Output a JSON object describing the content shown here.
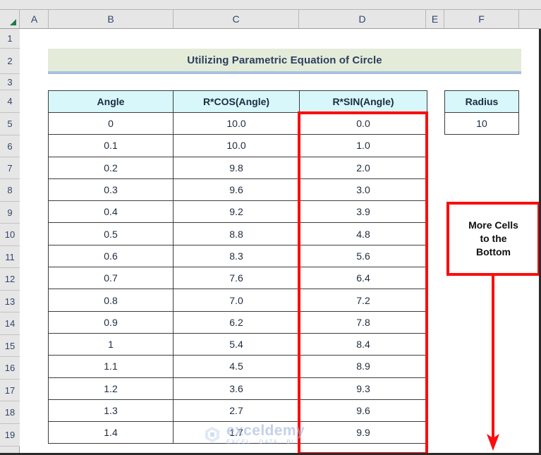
{
  "app": {
    "type": "spreadsheet",
    "select_all_icon": "select-all-corner-triangle"
  },
  "grid": {
    "column_headers": [
      "A",
      "B",
      "C",
      "D",
      "E",
      "F"
    ],
    "row_headers": [
      "1",
      "2",
      "3",
      "4",
      "5",
      "6",
      "7",
      "8",
      "9",
      "10",
      "11",
      "12",
      "13",
      "14",
      "15",
      "16",
      "17",
      "18",
      "19"
    ]
  },
  "title_banner": {
    "text": "Utilizing Parametric Equation of Circle",
    "fill_color": "#e4ecd9",
    "underline_color": "#a8c0e0",
    "text_color": "#2c3f5e"
  },
  "table": {
    "headers": [
      "Angle",
      "R*COS(Angle)",
      "R*SIN(Angle)"
    ],
    "header_fill": "#d7f7fb",
    "rows": [
      [
        "0",
        "10.0",
        "0.0"
      ],
      [
        "0.1",
        "10.0",
        "1.0"
      ],
      [
        "0.2",
        "9.8",
        "2.0"
      ],
      [
        "0.3",
        "9.6",
        "3.0"
      ],
      [
        "0.4",
        "9.2",
        "3.9"
      ],
      [
        "0.5",
        "8.8",
        "4.8"
      ],
      [
        "0.6",
        "8.3",
        "5.6"
      ],
      [
        "0.7",
        "7.6",
        "6.4"
      ],
      [
        "0.8",
        "7.0",
        "7.2"
      ],
      [
        "0.9",
        "6.2",
        "7.8"
      ],
      [
        "1",
        "5.4",
        "8.4"
      ],
      [
        "1.1",
        "4.5",
        "8.9"
      ],
      [
        "1.2",
        "3.6",
        "9.3"
      ],
      [
        "1.3",
        "2.7",
        "9.6"
      ],
      [
        "1.4",
        "1.7",
        "9.9"
      ]
    ]
  },
  "radius_box": {
    "header": "Radius",
    "value": "10",
    "header_fill": "#d7f7fb"
  },
  "highlight": {
    "color": "#fc0d0d",
    "target_column": "R*SIN(Angle)"
  },
  "callout": {
    "lines": [
      "More Cells",
      "to the",
      "Bottom"
    ],
    "border_color": "#fc0d0d",
    "arrow_color": "#fc0d0d",
    "arrow_direction": "down"
  },
  "watermark": {
    "name": "exceldemy",
    "subtitle": "EXCEL · DATA · BI",
    "color": "#9fb6dd"
  },
  "chart_data": {
    "type": "table",
    "title": "Utilizing Parametric Equation of Circle",
    "columns": [
      "Angle",
      "R*COS(Angle)",
      "R*SIN(Angle)"
    ],
    "radius": 10,
    "x": [
      0,
      0.1,
      0.2,
      0.3,
      0.4,
      0.5,
      0.6,
      0.7,
      0.8,
      0.9,
      1,
      1.1,
      1.2,
      1.3,
      1.4
    ],
    "series": [
      {
        "name": "R*COS(Angle)",
        "values": [
          10.0,
          10.0,
          9.8,
          9.6,
          9.2,
          8.8,
          8.3,
          7.6,
          7.0,
          6.2,
          5.4,
          4.5,
          3.6,
          2.7,
          1.7
        ]
      },
      {
        "name": "R*SIN(Angle)",
        "values": [
          0.0,
          1.0,
          2.0,
          3.0,
          3.9,
          4.8,
          5.6,
          6.4,
          7.2,
          7.8,
          8.4,
          8.9,
          9.3,
          9.6,
          9.9
        ]
      }
    ],
    "xlabel": "Angle",
    "ylabel": ""
  }
}
